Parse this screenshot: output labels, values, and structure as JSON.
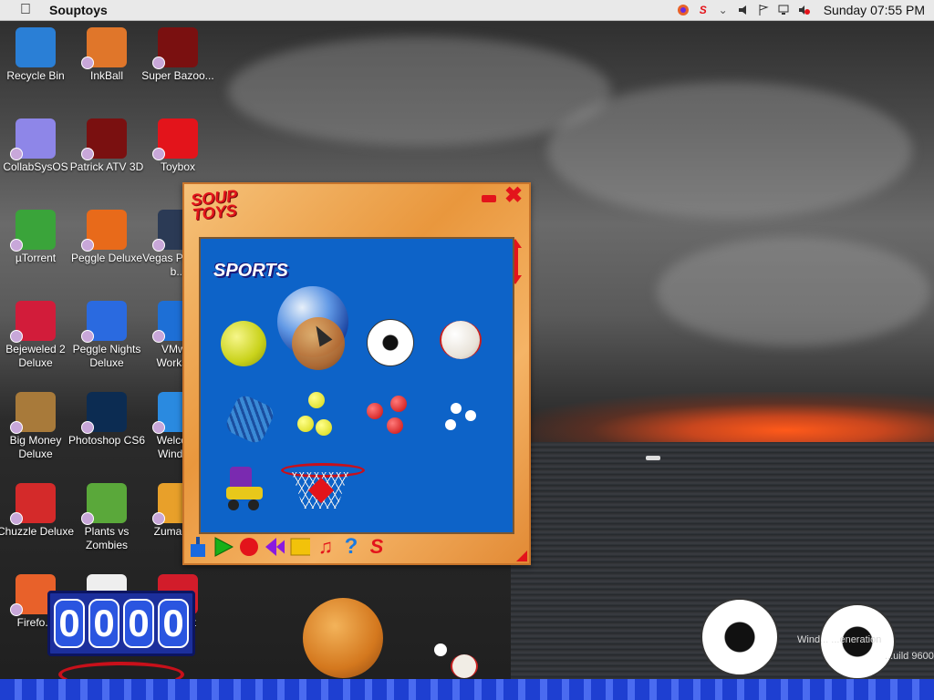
{
  "menubar": {
    "app_name": "Souptoys",
    "clock": "Sunday 07:55 PM",
    "tray_icons": [
      "firefox-icon",
      "souptoys-icon",
      "chevron-down-icon",
      "speaker-icon",
      "flag-icon",
      "network-icon",
      "volume-muted-icon"
    ]
  },
  "desktop": {
    "icons": [
      {
        "label": "Recycle Bin",
        "icon": "recycle-bin-icon",
        "color": "#2a7fd6"
      },
      {
        "label": "InkBall",
        "icon": "inkball-icon",
        "color": "#e0762a"
      },
      {
        "label": "Super Bazoo...",
        "icon": "flash-icon",
        "color": "#7a1010"
      },
      {
        "label": "CollabSysOS",
        "icon": "folder-icon",
        "color": "#8e86e8"
      },
      {
        "label": "Patrick ATV 3D",
        "icon": "flash-icon",
        "color": "#7a1010"
      },
      {
        "label": "Toybox",
        "icon": "souptoys-s-icon",
        "color": "#e3141b"
      },
      {
        "label": "µTorrent",
        "icon": "utorrent-icon",
        "color": "#3aa43a"
      },
      {
        "label": "Peggle Deluxe",
        "icon": "peggle-icon",
        "color": "#e86a1a"
      },
      {
        "label": "Vegas P... (64-b...",
        "icon": "vegas-icon",
        "color": "#2b3a55"
      },
      {
        "label": "Bejeweled 2 Deluxe",
        "icon": "bejeweled-icon",
        "color": "#d21c3a"
      },
      {
        "label": "Peggle Nights Deluxe",
        "icon": "peggle-nights-icon",
        "color": "#2a6ae0"
      },
      {
        "label": "VMw... Workst...",
        "icon": "vmware-icon",
        "color": "#1d6fd6"
      },
      {
        "label": "Big Money Deluxe",
        "icon": "money-bag-icon",
        "color": "#a87a3a"
      },
      {
        "label": "Photoshop CS6",
        "icon": "photoshop-icon",
        "color": "#0c2c52"
      },
      {
        "label": "Welcor... Windo...",
        "icon": "windows-icon",
        "color": "#2a8ae0"
      },
      {
        "label": "Chuzzle Deluxe",
        "icon": "chuzzle-icon",
        "color": "#d42a2a"
      },
      {
        "label": "Plants vs Zombies",
        "icon": "plants-vs-zombies-icon",
        "color": "#5aa83a"
      },
      {
        "label": "Zuma D...",
        "icon": "zuma-icon",
        "color": "#e8a02a"
      },
      {
        "label": "Firefo...",
        "icon": "firefox-icon",
        "color": "#e8612a"
      },
      {
        "label": "",
        "icon": "blank-file-icon",
        "color": "#eeeeee"
      },
      {
        "label": "...g ...et",
        "icon": "game-icon",
        "color": "#d21c2a"
      }
    ]
  },
  "souptoys_window": {
    "logo": "SOUP TOYS",
    "category_title": "SPORTS",
    "toys": [
      "tennis-ball",
      "beach-ball",
      "soccer-ball",
      "baseball",
      "slinky",
      "ping-pong-balls",
      "red-balls",
      "white-balls",
      "roller-skate",
      "basketball-hoop"
    ],
    "toolbar": [
      "pump-icon",
      "play-icon",
      "record-icon",
      "rewind-icon",
      "stop-icon",
      "music-icon",
      "help-icon",
      "souptoys-s-icon"
    ]
  },
  "score_display": {
    "digits": [
      "0",
      "0",
      "0",
      "0"
    ]
  },
  "windows_watermark": {
    "line1": "Wind... ...eneration",
    "line2": "...uild 9600"
  }
}
